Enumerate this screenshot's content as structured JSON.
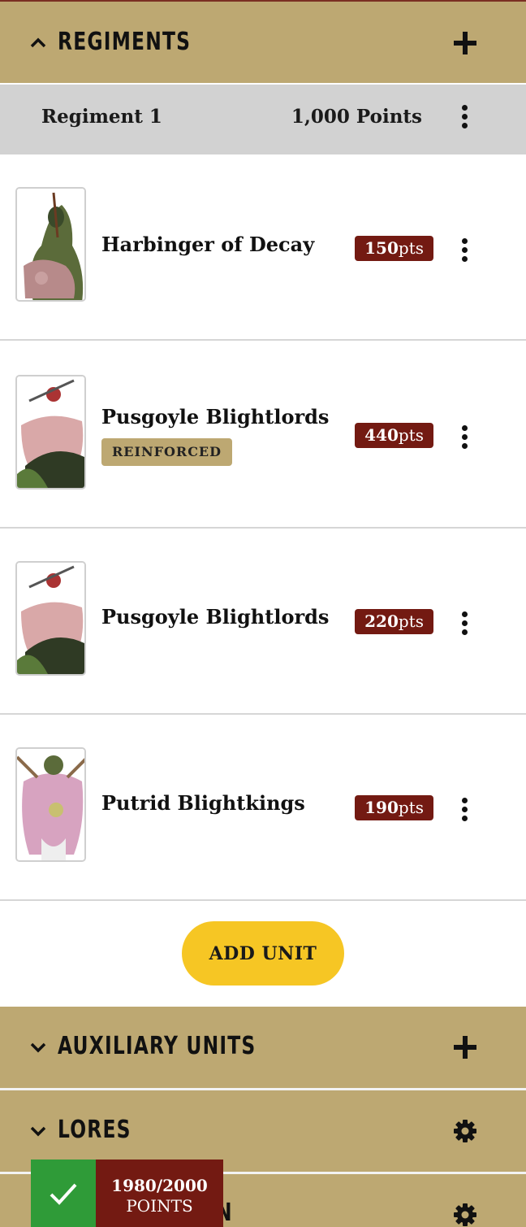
{
  "sections": {
    "regiments": {
      "title": "REGIMENTS",
      "action_icon": "plus-icon",
      "expanded": true
    },
    "auxiliary": {
      "title": "AUXILIARY UNITS",
      "action_icon": "plus-icon",
      "expanded": false
    },
    "lores": {
      "title": "LORES",
      "action_icon": "gear-icon",
      "expanded": false
    },
    "fourth": {
      "title": "N",
      "action_icon": "gear-icon",
      "expanded": false
    }
  },
  "regiment": {
    "name": "Regiment 1",
    "points": "1,000 Points"
  },
  "units": [
    {
      "name": "Harbinger of Decay",
      "points_value": "150",
      "points_unit": "pts",
      "badge": ""
    },
    {
      "name": "Pusgoyle Blightlords",
      "points_value": "440",
      "points_unit": "pts",
      "badge": "REINFORCED"
    },
    {
      "name": "Pusgoyle Blightlords",
      "points_value": "220",
      "points_unit": "pts",
      "badge": ""
    },
    {
      "name": "Putrid Blightkings",
      "points_value": "190",
      "points_unit": "pts",
      "badge": ""
    }
  ],
  "add_unit_label": "ADD UNIT",
  "points_summary": {
    "count": "1980/2000",
    "label": "POINTS",
    "status_icon": "checkmark-icon"
  },
  "colors": {
    "header": "#bda872",
    "regiment_bar": "#d2d2d2",
    "points_badge": "#731a12",
    "add_button": "#f6c624",
    "status_ok": "#2f9b38"
  }
}
